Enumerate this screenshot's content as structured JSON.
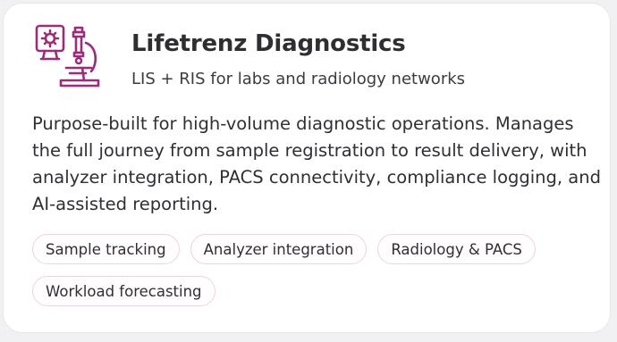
{
  "card": {
    "title": "Lifetrenz Diagnostics",
    "subtitle": "LIS + RIS for labs and radiology networks",
    "description": "Purpose-built for high-volume diagnostic operations. Manages the full journey from sample registration to result delivery, with analyzer integration, PACS connectivity, compliance logging, and AI-assisted reporting.",
    "icon": "microscope-monitor-icon",
    "tags": [
      "Sample tracking",
      "Analyzer integration",
      "Radiology & PACS",
      "Workload forecasting"
    ]
  },
  "colors": {
    "accent": "#9c2b7a",
    "background": "#f1f1f3",
    "card": "#ffffff",
    "tag_border": "#ecd4db",
    "text": "#2f2f35"
  }
}
